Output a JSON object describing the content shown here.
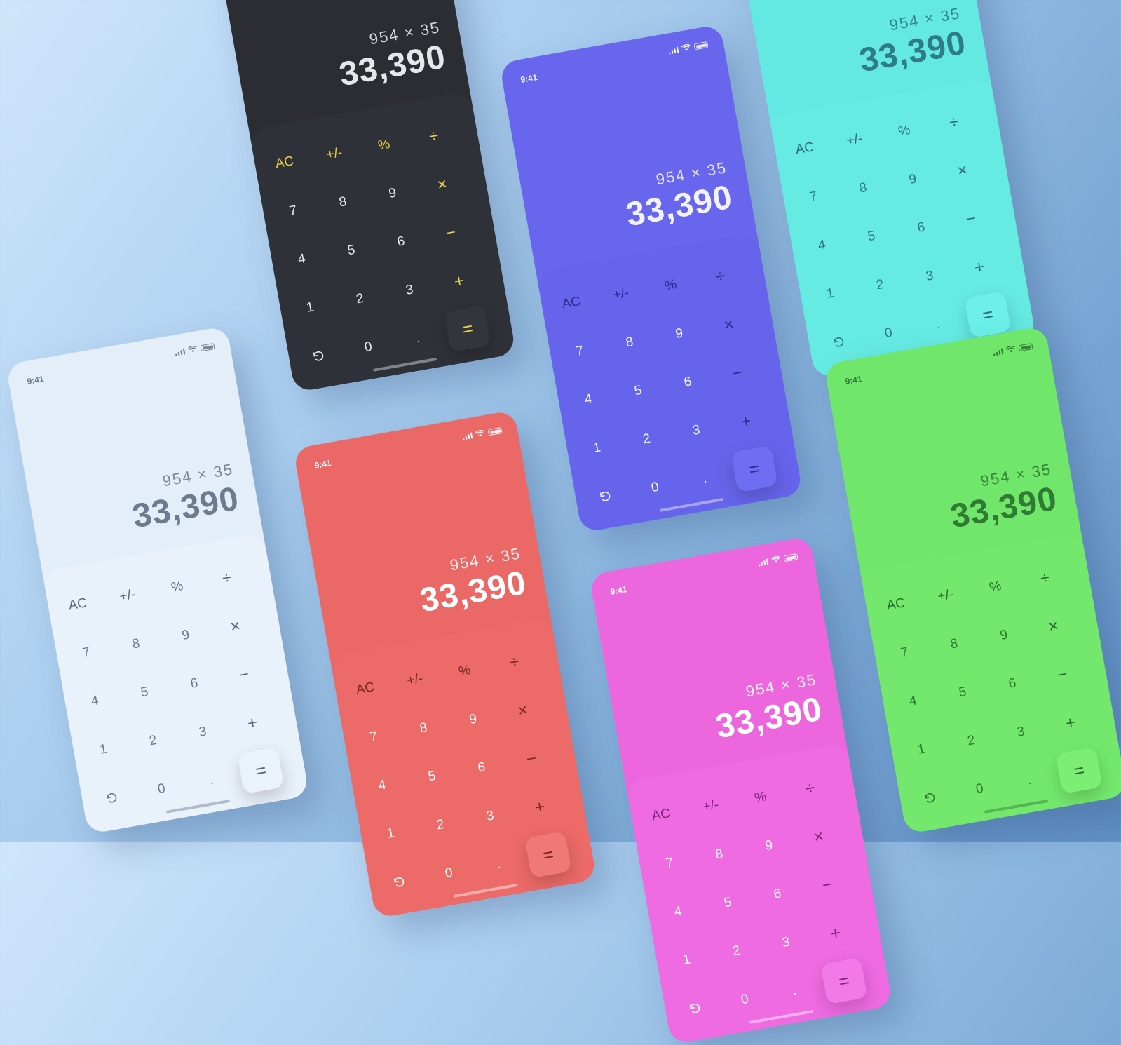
{
  "status": {
    "time": "9:41"
  },
  "calculator": {
    "expression": "954 × 35",
    "result": "33,390"
  },
  "keys": {
    "row1": [
      "AC",
      "+/-",
      "%",
      "÷"
    ],
    "row2": [
      "7",
      "8",
      "9",
      "×"
    ],
    "row3": [
      "4",
      "5",
      "6",
      "−"
    ],
    "row4": [
      "1",
      "2",
      "3",
      "+"
    ],
    "row5": [
      "0",
      ".",
      "="
    ]
  },
  "themes": [
    {
      "name": "white",
      "screen": "#e4eef9",
      "keypad": "#e9f1fb",
      "text": "#6e7b8e",
      "accent": "#5a677a",
      "eq": "#eaf2fb"
    },
    {
      "name": "dark",
      "screen": "#2b2d33",
      "keypad": "#2f3138",
      "text": "#e6e7ea",
      "accent": "#e6cf4a",
      "eq": "#33353c"
    },
    {
      "name": "red",
      "screen": "#ea6966",
      "keypad": "#ec6a67",
      "text": "#ffffff",
      "accent": "#7d2626",
      "eq": "#f07876"
    },
    {
      "name": "purple",
      "screen": "#6966ee",
      "keypad": "#6664ea",
      "text": "#f3f3ff",
      "accent": "#2e2a8c",
      "eq": "#6f6ef3"
    },
    {
      "name": "pink",
      "screen": "#ec67de",
      "keypad": "#ee6be1",
      "text": "#ffffff",
      "accent": "#7a2578",
      "eq": "#f17ae6"
    },
    {
      "name": "cyan",
      "screen": "#63e9e1",
      "keypad": "#66ebe3",
      "text": "#2f7b86",
      "accent": "#2e6c78",
      "eq": "#6cf0e8"
    },
    {
      "name": "green",
      "screen": "#70e66a",
      "keypad": "#74e86d",
      "text": "#2f7b34",
      "accent": "#2b6a2f",
      "eq": "#7cee74"
    }
  ]
}
